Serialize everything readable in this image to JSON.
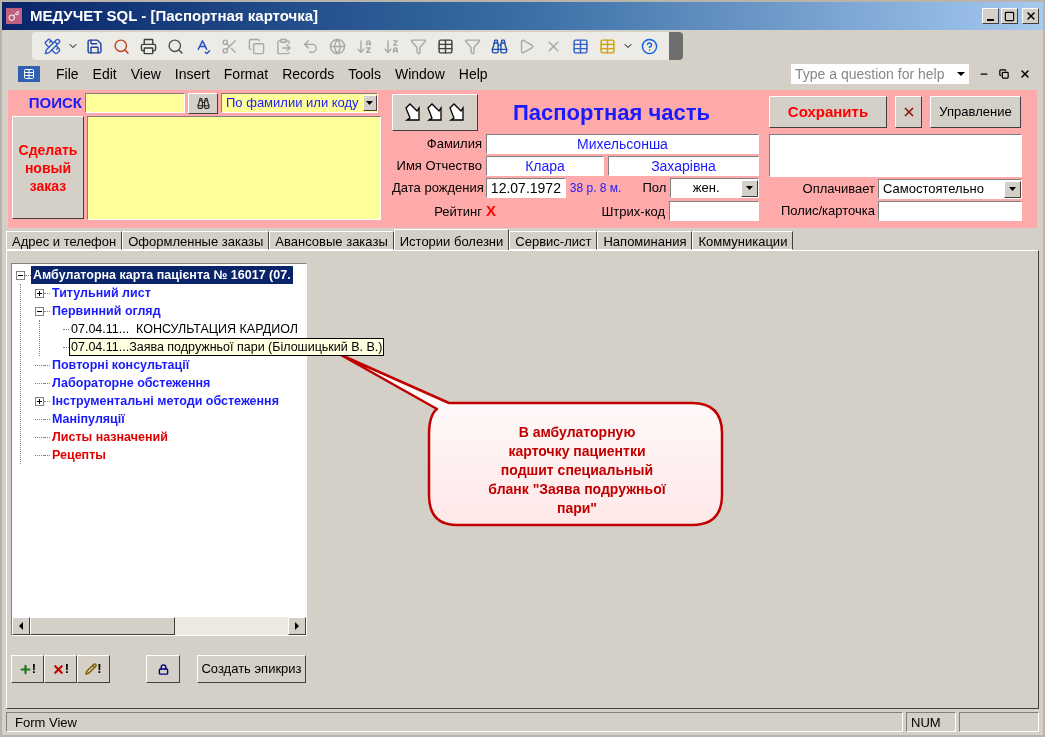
{
  "window": {
    "title": "МЕДУЧЕТ SQL - [Паспортная карточка]"
  },
  "menu": [
    "File",
    "Edit",
    "View",
    "Insert",
    "Format",
    "Records",
    "Tools",
    "Window",
    "Help"
  ],
  "help_box": {
    "placeholder": "Type a question for help"
  },
  "search": {
    "label": "ПОИСК",
    "mode": "По фамилии или коду"
  },
  "new_order_button": "Сделать новый заказ",
  "form_title": "Паспортная часть",
  "save_button": "Сохранить",
  "manage_button": "Управление",
  "fields": {
    "surname_label": "Фамилия",
    "surname": "Михельсонша",
    "name_label": "Имя Отчество",
    "first_name": "Клара",
    "patronymic": "Захарівна",
    "birth_label": "Дата рождения",
    "birth_date": "12.07.1972",
    "age": "38 р. 8 м.",
    "sex_label": "Пол",
    "sex": "жен.",
    "rating_label": "Рейтинг",
    "rating": "X",
    "barcode_label": "Штрих-код",
    "payer_label": "Оплачивает",
    "payer": "Самостоятельно",
    "policy_label": "Полис/карточка"
  },
  "tabs": [
    {
      "label": "Адрес и телефон",
      "selected": false
    },
    {
      "label": "Оформленные заказы",
      "selected": false
    },
    {
      "label": "Авансовые заказы",
      "selected": false
    },
    {
      "label": "Истории болезни",
      "selected": true
    },
    {
      "label": "Сервис-лист",
      "selected": false
    },
    {
      "label": "Напоминания",
      "selected": false
    },
    {
      "label": "Коммуникации",
      "selected": false
    }
  ],
  "tree": [
    {
      "label": "Амбулаторна карта пацієнта № 16017 (07.",
      "kind": "group",
      "expanded": true,
      "selected": true,
      "children": [
        {
          "label": "Титульний лист",
          "kind": "group",
          "expanded": false,
          "selected": false,
          "color": "#1a1aff"
        },
        {
          "label": "Первинний огляд",
          "kind": "group",
          "expanded": true,
          "selected": false,
          "color": "#1a1aff",
          "children": [
            {
              "label": "07.04.11...  КОНСУЛЬТАЦИЯ КАРДИОЛ",
              "kind": "entry",
              "hovered": false,
              "selected": false,
              "color": "#000000"
            },
            {
              "label": "07.04.11...Заява подружньої пари (Білошицький В. В.)",
              "kind": "entry",
              "hovered": true,
              "selected": false,
              "color": "#000000"
            }
          ]
        },
        {
          "label": "Повторні консультації",
          "kind": "item",
          "selected": false,
          "color": "#1a1aff"
        },
        {
          "label": "Лабораторне обстеження",
          "kind": "item",
          "selected": false,
          "color": "#1a1aff"
        },
        {
          "label": "Інструментальні методи обстеження",
          "kind": "group",
          "expanded": false,
          "selected": false,
          "color": "#1a1aff"
        },
        {
          "label": "Маніпуляції",
          "kind": "item",
          "selected": false,
          "color": "#1a1aff"
        },
        {
          "label": "Листы назначений",
          "kind": "item",
          "selected": false,
          "color": "#e00000"
        },
        {
          "label": "Рецепты",
          "kind": "item",
          "selected": false,
          "color": "#e00000"
        }
      ]
    }
  ],
  "tree_buttons": [
    {
      "kind": "add",
      "label": "!"
    },
    {
      "kind": "delete",
      "label": "!"
    },
    {
      "kind": "edit",
      "label": "!"
    }
  ],
  "epicrisis_button": "Создать эпикриз",
  "callout": "В амбулаторную карточку пациентки подшит специальный бланк \"Заява подружньої пари\"",
  "status_bar": {
    "mode": "Form View",
    "num": "NUM"
  }
}
